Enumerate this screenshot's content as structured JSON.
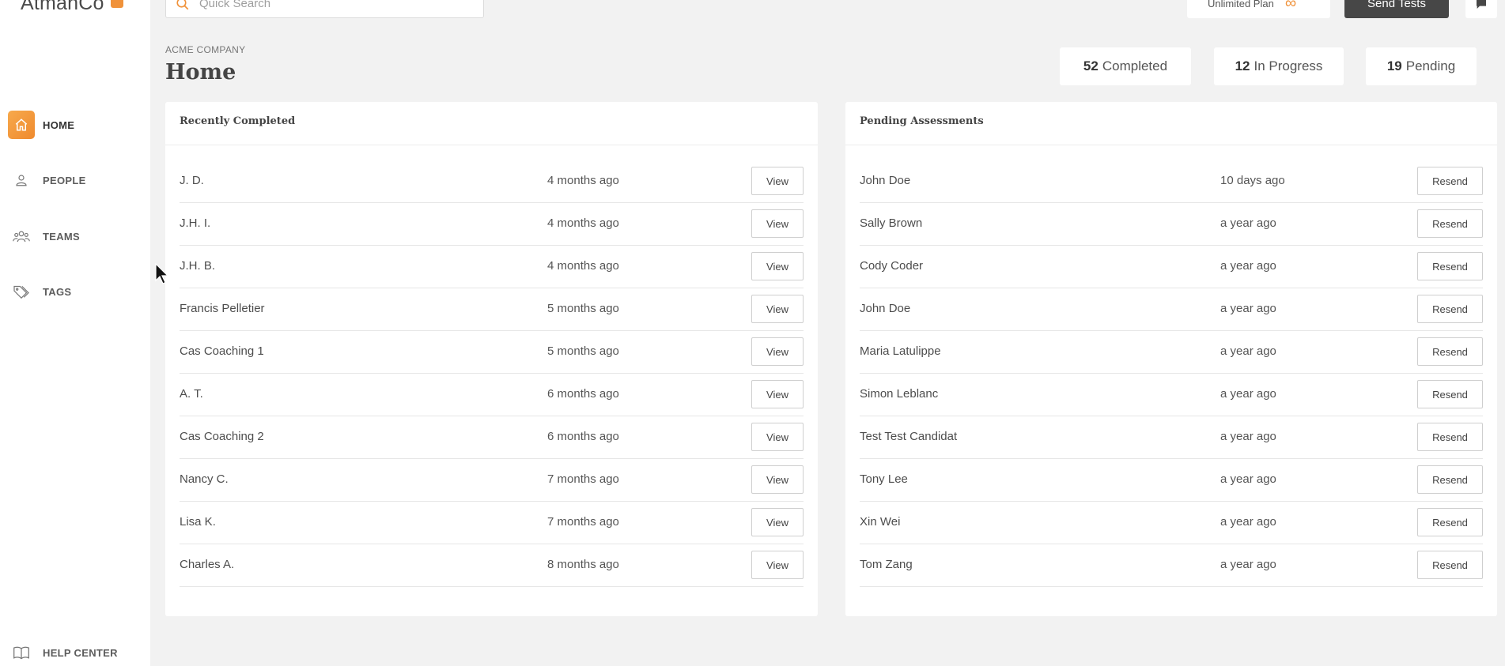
{
  "app": {
    "logo": "AtmanCo"
  },
  "search": {
    "placeholder": "Quick Search"
  },
  "topbar": {
    "plan_label": "Unlimited Plan",
    "plan_symbol": "∞",
    "send_label": "Send Tests"
  },
  "nav": {
    "items": [
      {
        "label": "HOME",
        "icon": "home-icon",
        "active": true
      },
      {
        "label": "PEOPLE",
        "icon": "person-icon",
        "active": false
      },
      {
        "label": "TEAMS",
        "icon": "team-icon",
        "active": false
      },
      {
        "label": "TAGS",
        "icon": "tag-icon",
        "active": false
      }
    ],
    "help": {
      "label": "HELP CENTER",
      "icon": "book-icon"
    }
  },
  "header": {
    "company": "ACME COMPANY",
    "title": "Home"
  },
  "stats": [
    {
      "count": "52",
      "label": "Completed"
    },
    {
      "count": "12",
      "label": "In Progress"
    },
    {
      "count": "19",
      "label": "Pending"
    }
  ],
  "recent": {
    "title": "Recently Completed",
    "button_label": "View",
    "rows": [
      {
        "name": "J. D.",
        "time": "4 months ago"
      },
      {
        "name": "J.H. I.",
        "time": "4 months ago"
      },
      {
        "name": "J.H. B.",
        "time": "4 months ago"
      },
      {
        "name": "Francis Pelletier",
        "time": "5 months ago"
      },
      {
        "name": "Cas Coaching 1",
        "time": "5 months ago"
      },
      {
        "name": "A. T.",
        "time": "6 months ago"
      },
      {
        "name": "Cas Coaching 2",
        "time": "6 months ago"
      },
      {
        "name": "Nancy C.",
        "time": "7 months ago"
      },
      {
        "name": "Lisa K.",
        "time": "7 months ago"
      },
      {
        "name": "Charles A.",
        "time": "8 months ago"
      }
    ]
  },
  "pending": {
    "title": "Pending Assessments",
    "button_label": "Resend",
    "rows": [
      {
        "name": "John Doe",
        "time": "10 days ago"
      },
      {
        "name": "Sally Brown",
        "time": "a year ago"
      },
      {
        "name": "Cody Coder",
        "time": "a year ago"
      },
      {
        "name": "John Doe",
        "time": "a year ago"
      },
      {
        "name": "Maria Latulippe",
        "time": "a year ago"
      },
      {
        "name": "Simon Leblanc",
        "time": "a year ago"
      },
      {
        "name": "Test Test Candidat",
        "time": "a year ago"
      },
      {
        "name": "Tony Lee",
        "time": "a year ago"
      },
      {
        "name": "Xin Wei",
        "time": "a year ago"
      },
      {
        "name": "Tom Zang",
        "time": "a year ago"
      }
    ]
  },
  "colors": {
    "accent": "#f0923a",
    "dark_button": "#474747",
    "background": "#f2f2f2"
  }
}
